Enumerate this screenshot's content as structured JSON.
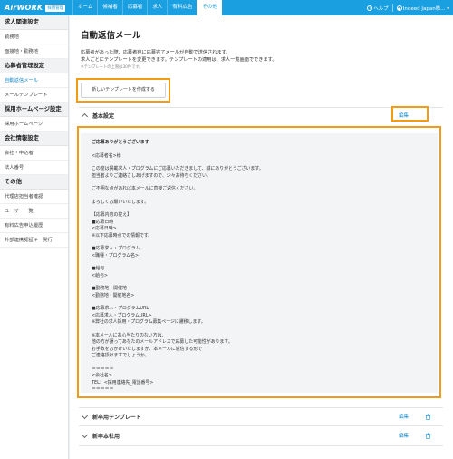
{
  "header": {
    "logo": "AirWORK",
    "logo_badge": "採用管理",
    "tabs": [
      "ホーム",
      "候補者",
      "応募者",
      "求人",
      "有料広告",
      "その他"
    ],
    "active_tab": 5,
    "help": "ヘルプ",
    "account": "Indeed Japan株..."
  },
  "sidebar": {
    "groups": [
      {
        "title": "求人関連設定",
        "items": [
          "勤務地",
          "面接地・勤務地"
        ]
      },
      {
        "title": "応募者管理設定",
        "items": [
          "自動返信メール",
          "メールテンプレート"
        ]
      },
      {
        "title": "採用ホームページ設定",
        "items": [
          "採用ホームページ"
        ]
      },
      {
        "title": "会社情報設定",
        "items": [
          "会社・申込者",
          "法人番号"
        ]
      },
      {
        "title": "その他",
        "items": [
          "代理店担当者確認",
          "ユーザー一覧",
          "有料広告申込履歴",
          "外部連携認証キー発行"
        ]
      }
    ],
    "active_item": "自動返信メール"
  },
  "main": {
    "title": "自動返信メール",
    "desc_line1": "応募者があった際、応募者宛に応募完了メールが自動で送信されます。",
    "desc_line2": "求人ごとにテンプレートを変更できます。テンプレートの適用は、求人一覧画面でできます。",
    "note": "※テンプレートの上限は30件です。",
    "new_template_button": "新しいテンプレートを作成する",
    "sections": [
      {
        "title": "基本設定",
        "expanded": true,
        "edit": "編集"
      },
      {
        "title": "新卒用テンプレート",
        "expanded": false,
        "edit": "編集"
      },
      {
        "title": "新卒本社用",
        "expanded": false,
        "edit": "編集"
      }
    ],
    "mail_body": [
      "ご応募ありがとうございます",
      "<応募者名>様",
      "この度は掲載求人・プログラムにご応募いただきまして、誠にありがとうございます。\n担当者よりご連絡さしあげますので、少々お待ちください。",
      "ご不明な点があれば本メールに直接ご返信ください。",
      "よろしくお願いいたします。",
      "【応募内容の控え】\n■応募日時\n<応募日時>\n※以下応募時点での情報です。",
      "■応募求人・プログラム\n<職種・プログラム名>",
      "■給与\n<給与>",
      "■勤務地・開催地\n<勤務地・開催地名>",
      "■応募求人・プログラムURL\n<応募求人・プログラムURL>\n※弊社の求人採用・プログラム募集ページに遷移します。",
      "※本メールにお心当たりのない方は、\n他の方が誤ってあなたのメールアドレスで応募した可能性があります。\nお手数をおかけいたしますが、本メールに返信する形で\nご連絡頂けますでしょうか。",
      "＝＝＝＝＝\n<会社名>\nTEL：<採用連絡先_電話番号>\n＝＝＝＝＝"
    ]
  },
  "colors": {
    "brand": "#1a9fe0",
    "link": "#1a8fd0",
    "highlight": "#f39c12"
  }
}
